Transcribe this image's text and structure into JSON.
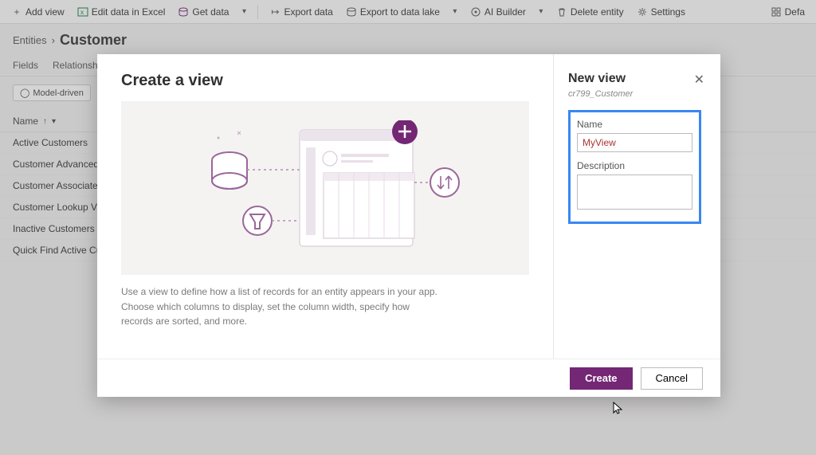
{
  "toolbar": {
    "add_view": "Add view",
    "edit_excel": "Edit data in Excel",
    "get_data": "Get data",
    "export_data": "Export data",
    "export_lake": "Export to data lake",
    "ai_builder": "AI Builder",
    "delete_entity": "Delete entity",
    "settings": "Settings",
    "default_right": "Defa"
  },
  "breadcrumb": {
    "root": "Entities",
    "current": "Customer"
  },
  "tabs": {
    "fields": "Fields",
    "relationships": "Relationships"
  },
  "pill": "Model-driven",
  "tableHeader": {
    "name": "Name"
  },
  "rows": [
    "Active Customers",
    "Customer Advanced Find",
    "Customer Associated View",
    "Customer Lookup View",
    "Inactive Customers",
    "Quick Find Active Custom"
  ],
  "dialog": {
    "title": "Create a view",
    "help": "Use a view to define how a list of records for an entity appears in your app. Choose which columns to display, set the column width, specify how records are sorted, and more.",
    "right_title": "New view",
    "right_sub": "cr799_Customer",
    "name_label": "Name",
    "name_value": "MyView",
    "desc_label": "Description",
    "desc_value": "",
    "create": "Create",
    "cancel": "Cancel"
  }
}
